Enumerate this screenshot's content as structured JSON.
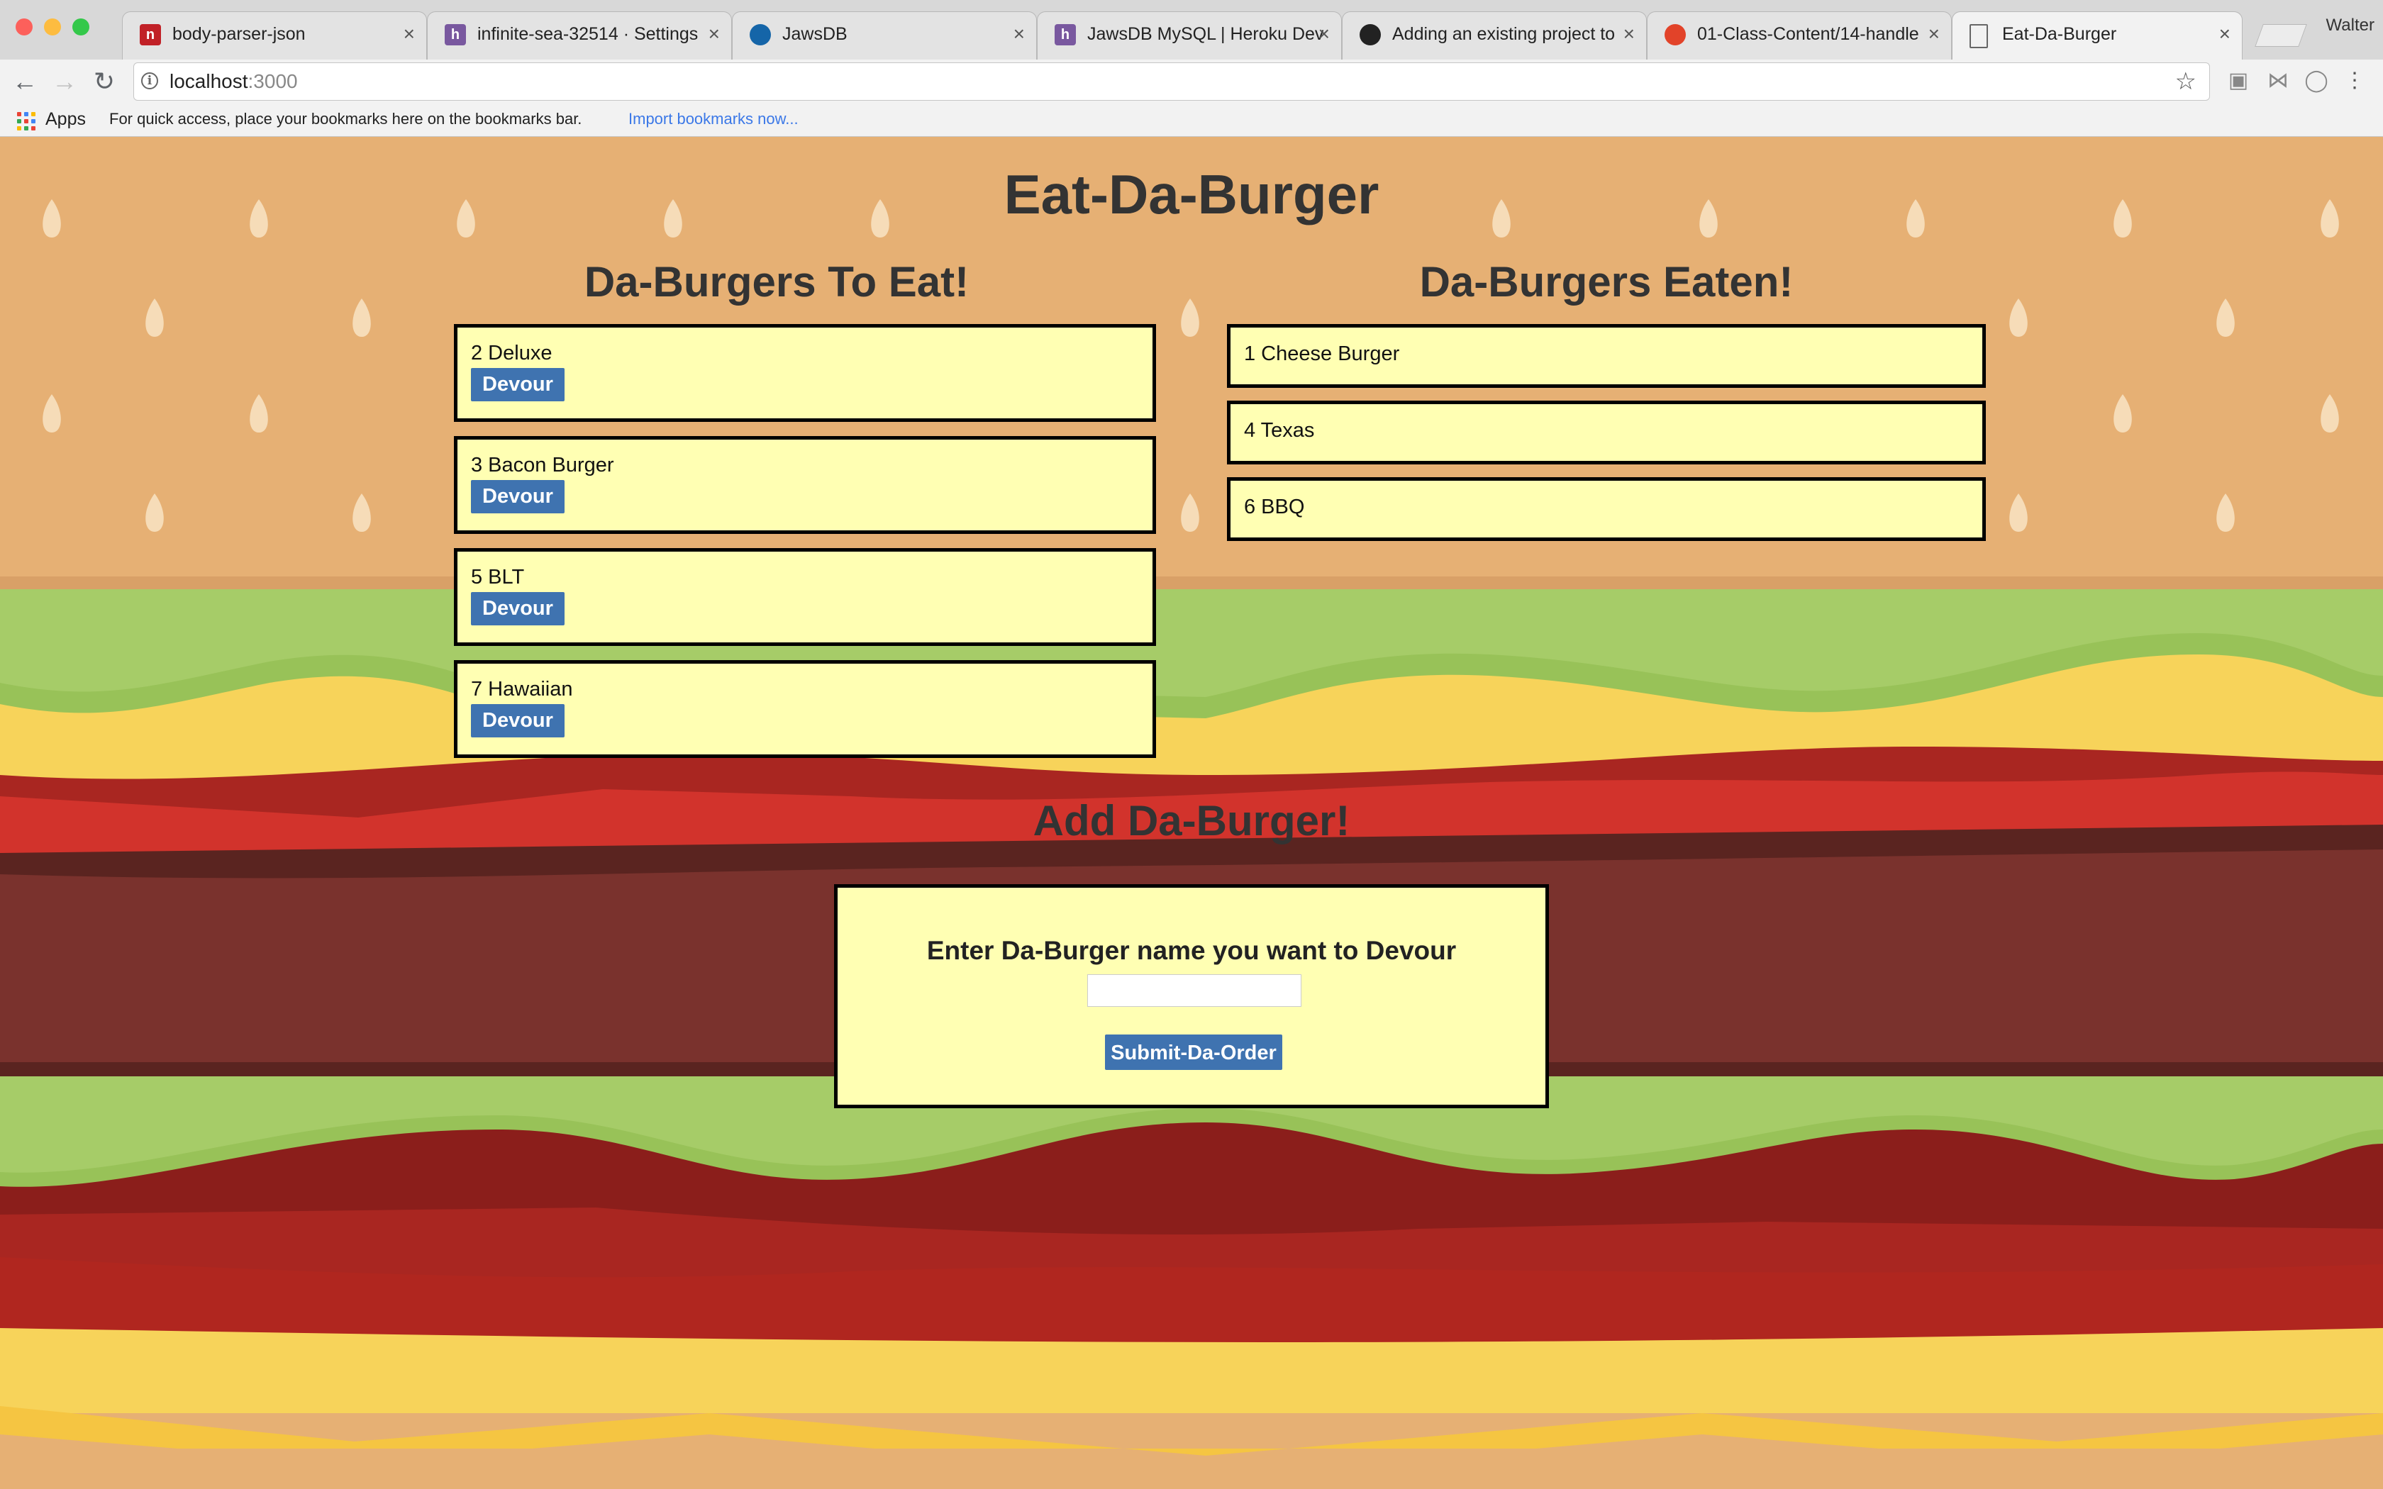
{
  "browser": {
    "window_buttons": [
      "close",
      "minimize",
      "zoom"
    ],
    "tabs": [
      {
        "title": "body-parser-json",
        "favicon": "npm-icon",
        "color": "#c12127"
      },
      {
        "title": "infinite-sea-32514 · Settings",
        "favicon": "heroku-icon",
        "color": "#79589f"
      },
      {
        "title": "JawsDB",
        "favicon": "jawsdb-icon",
        "color": "#1565a8"
      },
      {
        "title": "JawsDB MySQL | Heroku Dev",
        "favicon": "heroku-icon",
        "color": "#79589f"
      },
      {
        "title": "Adding an existing project to",
        "favicon": "github-icon",
        "color": "#222222"
      },
      {
        "title": "01-Class-Content/14-handle",
        "favicon": "gitlab-icon",
        "color": "#e24329"
      },
      {
        "title": "Eat-Da-Burger",
        "favicon": "page-icon",
        "color": "#ffffff",
        "active": true
      }
    ],
    "profile_name": "Walter",
    "url_host": "localhost",
    "url_port": ":3000",
    "bookmarks": {
      "apps_label": "Apps",
      "prompt": "For quick access, place your bookmarks here on the bookmarks bar.",
      "import_link": "Import bookmarks now..."
    }
  },
  "page": {
    "title": "Eat-Da-Burger",
    "to_eat_heading": "Da-Burgers To Eat!",
    "eaten_heading": "Da-Burgers Eaten!",
    "devour_label": "Devour",
    "to_eat": [
      "2 Deluxe",
      "3 Bacon Burger",
      "5 BLT",
      "7 Hawaiian"
    ],
    "eaten": [
      "1 Cheese Burger",
      "4 Texas",
      "6 BBQ"
    ],
    "add_heading": "Add Da-Burger!",
    "form_label": "Enter Da-Burger name you want to Devour",
    "input_value": "",
    "submit_label": "Submit-Da-Order"
  },
  "colors": {
    "bun": "#e6b074",
    "seed": "#f6dcb8",
    "lettuce": "#a6cc68",
    "lettuce_dark": "#98c258",
    "cheese": "#f7d35a",
    "tomato": "#d2332c",
    "tomato_dark": "#a92621",
    "patty": "#7a322d",
    "patty_dark": "#5a2420",
    "card_bg": "#ffffb3",
    "button": "#3f73b0",
    "heading": "#333333"
  }
}
